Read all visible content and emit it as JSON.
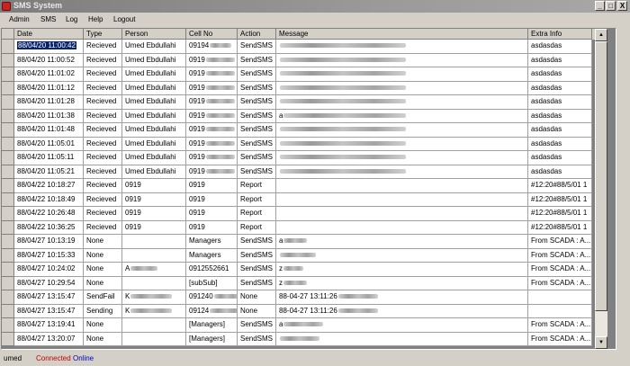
{
  "window": {
    "title": "SMS System",
    "minimize": "_",
    "maximize": "□",
    "close": "X"
  },
  "menu": [
    "Admin",
    "SMS",
    "Log",
    "Help",
    "Logout"
  ],
  "columns": [
    "Date",
    "Type",
    "Person",
    "Cell No",
    "Action",
    "Message",
    "Extra Info"
  ],
  "rows": [
    [
      "88/04/20 11:00:42",
      "Recieved",
      "Umed Ebdullahi",
      "09194",
      "SendSMS",
      "",
      "asdasdas"
    ],
    [
      "88/04/20 11:00:52",
      "Recieved",
      "Umed Ebdullahi",
      "0919",
      "SendSMS",
      "",
      "asdasdas"
    ],
    [
      "88/04/20 11:01:02",
      "Recieved",
      "Umed Ebdullahi",
      "0919",
      "SendSMS",
      "",
      "asdasdas"
    ],
    [
      "88/04/20 11:01:12",
      "Recieved",
      "Umed Ebdullahi",
      "0919",
      "SendSMS",
      "",
      "asdasdas"
    ],
    [
      "88/04/20 11:01:28",
      "Recieved",
      "Umed Ebdullahi",
      "0919",
      "SendSMS",
      "",
      "asdasdas"
    ],
    [
      "88/04/20 11:01:38",
      "Recieved",
      "Umed Ebdullahi",
      "0919",
      "SendSMS",
      "a",
      "asdasdas"
    ],
    [
      "88/04/20 11:01:48",
      "Recieved",
      "Umed Ebdullahi",
      "0919",
      "SendSMS",
      "",
      "asdasdas"
    ],
    [
      "88/04/20 11:05:01",
      "Recieved",
      "Umed Ebdullahi",
      "0919",
      "SendSMS",
      "",
      "asdasdas"
    ],
    [
      "88/04/20 11:05:11",
      "Recieved",
      "Umed Ebdullahi",
      "0919",
      "SendSMS",
      "",
      "asdasdas"
    ],
    [
      "88/04/20 11:05:21",
      "Recieved",
      "Umed Ebdullahi",
      "0919",
      "SendSMS",
      "",
      "asdasdas"
    ],
    [
      "88/04/22 10:18:27",
      "Recieved",
      "0919",
      "0919",
      "Report",
      "",
      "#12:20#88/5/01 1"
    ],
    [
      "88/04/22 10:18:49",
      "Recieved",
      "0919",
      "0919",
      "Report",
      "",
      "#12:20#88/5/01 1"
    ],
    [
      "88/04/22 10:26:48",
      "Recieved",
      "0919",
      "0919",
      "Report",
      "",
      "#12:20#88/5/01 1"
    ],
    [
      "88/04/22 10:36:25",
      "Recieved",
      "0919",
      "0919",
      "Report",
      "",
      "#12:20#88/5/01 1"
    ],
    [
      "88/04/27 10:13:19",
      "None",
      "",
      "Managers",
      "SendSMS",
      "a",
      "From SCADA : A..."
    ],
    [
      "88/04/27 10:15:33",
      "None",
      "",
      "Managers",
      "SendSMS",
      "",
      "From SCADA : A..."
    ],
    [
      "88/04/27 10:24:02",
      "None",
      "A",
      "0912552661",
      "SendSMS",
      "z",
      "From SCADA : A..."
    ],
    [
      "88/04/27 10:29:54",
      "None",
      "",
      "[subSub]",
      "SendSMS",
      "z",
      "From SCADA : A..."
    ],
    [
      "88/04/27 13:15:47",
      "SendFail",
      "K",
      "091240",
      "None",
      "88-04-27 13:11:26",
      ""
    ],
    [
      "88/04/27 13:15:47",
      "Sending",
      "K",
      "09124",
      "None",
      "88-04-27 13:11:26",
      ""
    ],
    [
      "88/04/27 13:19:41",
      "None",
      "",
      "[Managers]",
      "SendSMS",
      "a",
      "From SCADA : A..."
    ],
    [
      "88/04/27 13:20:07",
      "None",
      "",
      "[Managers]",
      "SendSMS",
      "",
      "From SCADA : A..."
    ]
  ],
  "status": {
    "user": "umed",
    "connection": "Connected",
    "online": "Online"
  },
  "colors": {
    "connected": "#c00000",
    "online": "#0000c0",
    "selection": "#0a246a"
  }
}
